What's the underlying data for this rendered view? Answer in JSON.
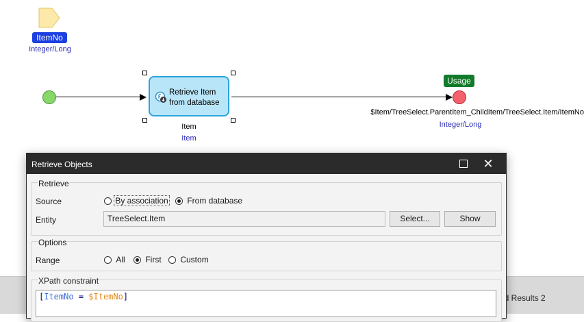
{
  "canvas": {
    "parameter": {
      "name": "ItemNo",
      "type": "Integer/Long"
    },
    "activity": {
      "label_line1": "Retrieve Item",
      "label_line2": "from database",
      "output_name": "Item",
      "output_type": "Item"
    },
    "end_event": {
      "badge": "Usage",
      "return_expression": "$Item/TreeSelect.ParentItem_ChildItem/TreeSelect.Item/ItemNo",
      "return_type": "Integer/Long"
    }
  },
  "bottom_pane": {
    "tab_fragment": "nd Results 2"
  },
  "dialog": {
    "title": "Retrieve Objects",
    "retrieve_group": {
      "title": "Retrieve",
      "source_label": "Source",
      "source_options": [
        "By association",
        "From database"
      ],
      "source_selected": "From database",
      "entity_label": "Entity",
      "entity_value": "TreeSelect.Item",
      "select_button": "Select...",
      "show_button": "Show"
    },
    "options_group": {
      "title": "Options",
      "range_label": "Range",
      "range_options": [
        "All",
        "First",
        "Custom"
      ],
      "range_selected": "First"
    },
    "xpath_group": {
      "title": "XPath constraint",
      "open_bracket": "[",
      "attribute": "ItemNo",
      "operator": " = ",
      "variable": "$ItemNo",
      "close_bracket": "]"
    }
  },
  "colors": {
    "parameter_badge": "#1b3fe0",
    "usage_badge": "#127a2b",
    "activity_fill": "#b9e5f8",
    "activity_border": "#2aa3dc",
    "start_event": "#86d86a",
    "end_event": "#f3626c",
    "type_text": "#2a2ab8",
    "titlebar": "#2b2b2b"
  },
  "icons": {
    "parameter": "parameter-icon",
    "activity": "database-retrieve-icon",
    "maximize": "maximize-icon",
    "close": "close-icon"
  }
}
